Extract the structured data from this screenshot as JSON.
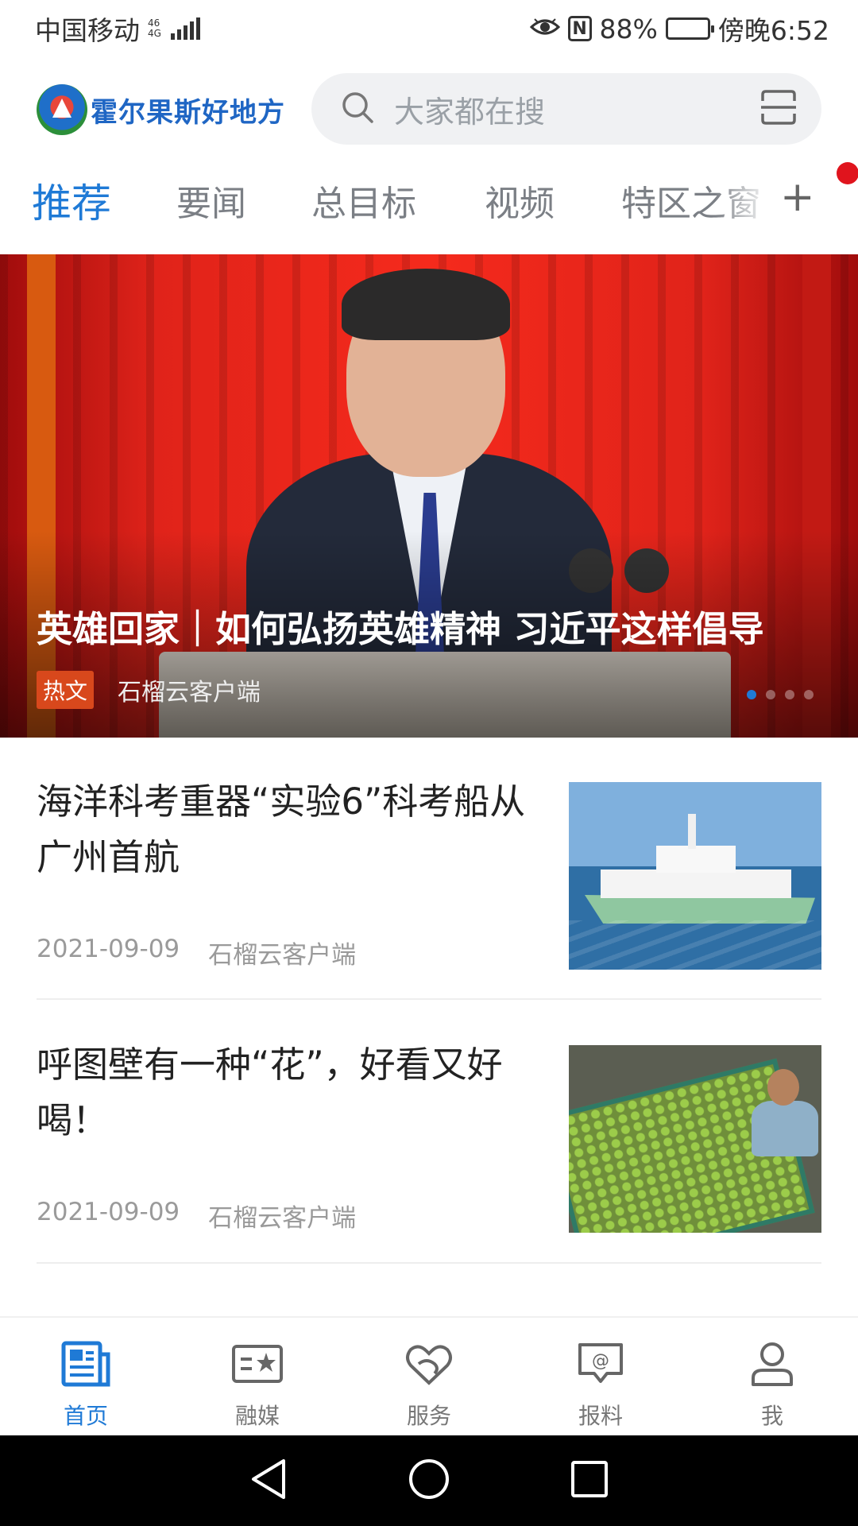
{
  "status_bar": {
    "carrier": "中国移动",
    "network_top": "46",
    "network_bottom": "4G",
    "battery_percent": "88%",
    "battery_level": 0.88,
    "time": "傍晚6:52"
  },
  "header": {
    "logo_text": "霍尔果斯好地方",
    "search_placeholder": "大家都在搜"
  },
  "tabs": [
    {
      "label": "推荐",
      "active": true
    },
    {
      "label": "要闻",
      "active": false
    },
    {
      "label": "总目标",
      "active": false
    },
    {
      "label": "视频",
      "active": false
    },
    {
      "label": "特区之窗",
      "active": false
    }
  ],
  "tabs_add": "+",
  "banner": {
    "title": "英雄回家｜如何弘扬英雄精神 习近平这样倡导",
    "badge": "热文",
    "source": "石榴云客户端",
    "slide_count": 4,
    "active_slide": 1
  },
  "news": [
    {
      "title": "海洋科考重器“实验6”科考船从广州首航",
      "date": "2021-09-09",
      "source": "石榴云客户端"
    },
    {
      "title": "呼图壁有一种“花”，好看又好喝！",
      "date": "2021-09-09",
      "source": "石榴云客户端"
    }
  ],
  "bottom_nav": [
    {
      "label": "首页",
      "icon": "news-icon",
      "active": true
    },
    {
      "label": "融媒",
      "icon": "media-card-icon",
      "active": false
    },
    {
      "label": "服务",
      "icon": "heart-hands-icon",
      "active": false
    },
    {
      "label": "报料",
      "icon": "report-bubble-icon",
      "active": false
    },
    {
      "label": "我",
      "icon": "user-icon",
      "active": false
    }
  ],
  "colors": {
    "accent": "#1f7ad6",
    "hot_badge": "#d8481c",
    "notification_dot": "#e0141d"
  }
}
